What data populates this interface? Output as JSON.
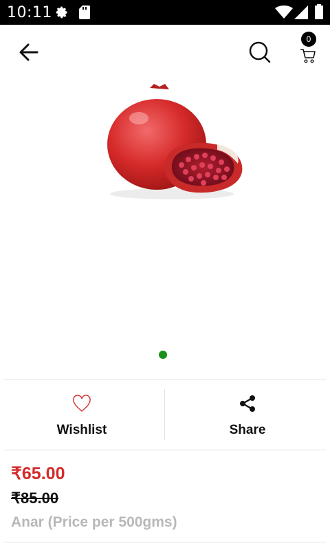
{
  "status_bar": {
    "time": "10:11",
    "icons": [
      "gear-icon",
      "sd-card-icon",
      "wifi-icon",
      "signal-icon",
      "battery-icon"
    ]
  },
  "app_bar": {
    "back_icon": "arrow-left-icon",
    "search_icon": "search-icon",
    "cart_icon": "cart-icon",
    "cart_count": "0"
  },
  "product": {
    "image": "pomegranate-image",
    "carousel_dots": 1,
    "price": "₹65.00",
    "mrp": "₹85.00",
    "name": "Anar (Price per 500gms)"
  },
  "actions": {
    "wishlist_label": "Wishlist",
    "share_label": "Share"
  },
  "colors": {
    "price": "#d42a2a",
    "indicator": "#1a8f1a",
    "heart": "#d42a2a"
  }
}
